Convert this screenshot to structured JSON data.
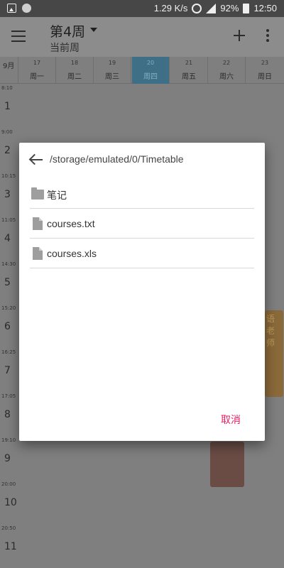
{
  "status_bar": {
    "speed": "1.29 K/s",
    "battery": "92%",
    "time": "12:50",
    "network_label": "4G"
  },
  "app_bar": {
    "week_title": "第4周",
    "week_subtitle": "当前周"
  },
  "calendar": {
    "month": "9月",
    "days": [
      {
        "num": "17",
        "name": "周一"
      },
      {
        "num": "18",
        "name": "周二"
      },
      {
        "num": "19",
        "name": "周三"
      },
      {
        "num": "20",
        "name": "周四"
      },
      {
        "num": "21",
        "name": "周五"
      },
      {
        "num": "22",
        "name": "周六"
      },
      {
        "num": "23",
        "name": "周日"
      }
    ],
    "slots": [
      {
        "time": "8:10",
        "num": "1"
      },
      {
        "time": "9:00",
        "num": "2"
      },
      {
        "time": "10:15",
        "num": "3"
      },
      {
        "time": "11:05",
        "num": "4"
      },
      {
        "time": "14:30",
        "num": "5"
      },
      {
        "time": "15:20",
        "num": "6"
      },
      {
        "time": "16:25",
        "num": "7"
      },
      {
        "time": "17:05",
        "num": "8"
      },
      {
        "time": "19:10",
        "num": "9"
      },
      {
        "time": "20:00",
        "num": "10"
      },
      {
        "time": "20:50",
        "num": "11"
      }
    ],
    "course_orange_text": "语 老师"
  },
  "dialog": {
    "path": "/storage/emulated/0/Timetable",
    "items": [
      {
        "type": "folder",
        "label": "笔记"
      },
      {
        "type": "file",
        "label": "courses.txt"
      },
      {
        "type": "file",
        "label": "courses.xls"
      }
    ],
    "cancel_label": "取消"
  },
  "colors": {
    "accent": "#e91e63",
    "today_highlight": "#3e6f86"
  }
}
